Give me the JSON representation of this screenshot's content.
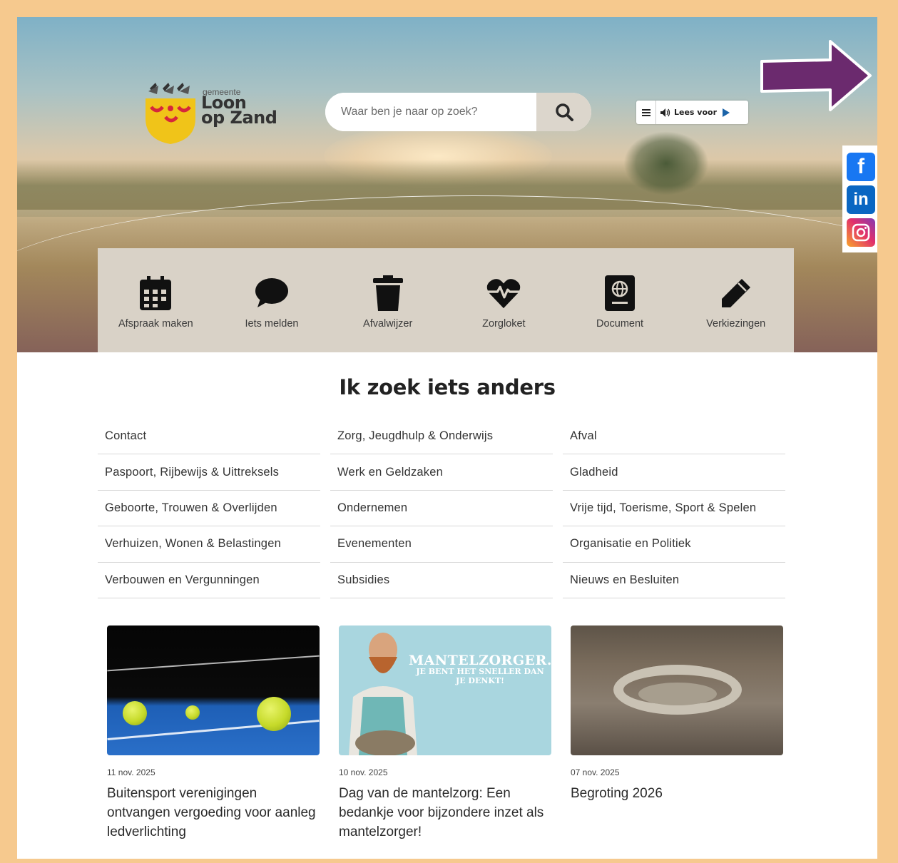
{
  "logo": {
    "small": "gemeente",
    "line1": "Loon",
    "line2": "op Zand"
  },
  "search": {
    "placeholder": "Waar ben je naar op zoek?"
  },
  "readspeaker": {
    "label": "Lees voor"
  },
  "social": [
    "facebook-icon",
    "linkedin-icon",
    "instagram-icon"
  ],
  "tiles": [
    {
      "label": "Afspraak maken",
      "icon": "calendar-icon"
    },
    {
      "label": "Iets melden",
      "icon": "speech-bubble-icon"
    },
    {
      "label": "Afvalwijzer",
      "icon": "trash-icon"
    },
    {
      "label": "Zorgloket",
      "icon": "heart-pulse-icon"
    },
    {
      "label": "Document",
      "icon": "passport-icon"
    },
    {
      "label": "Verkiezingen",
      "icon": "pencil-icon"
    }
  ],
  "section_title": "Ik zoek iets anders",
  "links": {
    "col1": [
      "Contact",
      "Paspoort, Rijbewijs & Uittreksels",
      "Geboorte, Trouwen & Overlijden",
      "Verhuizen, Wonen & Belastingen",
      "Verbouwen en Vergunningen"
    ],
    "col2": [
      "Zorg, Jeugdhulp & Onderwijs",
      "Werk en Geldzaken",
      "Ondernemen",
      "Evenementen",
      "Subsidies"
    ],
    "col3": [
      "Afval",
      "Gladheid",
      "Vrije tijd, Toerisme, Sport & Spelen",
      "Organisatie en Politiek",
      "Nieuws en Besluiten"
    ]
  },
  "news": [
    {
      "date": "11 nov. 2025",
      "title": "Buitensport verenigingen ontvangen vergoeding voor aanleg ledverlichting"
    },
    {
      "date": "10 nov. 2025",
      "title": "Dag van de mantelzorg: Een bedankje voor bijzondere inzet als mantelzorger!",
      "image_text1": "MANTELZORGER.",
      "image_text2": "JE BENT HET SNELLER DAN JE DENKT!"
    },
    {
      "date": "07 nov. 2025",
      "title": "Begroting 2026"
    }
  ],
  "colors": {
    "frame": "#f6c98e",
    "arrow": "#6b2a6e",
    "tile_bg": "#d9d2c7"
  }
}
